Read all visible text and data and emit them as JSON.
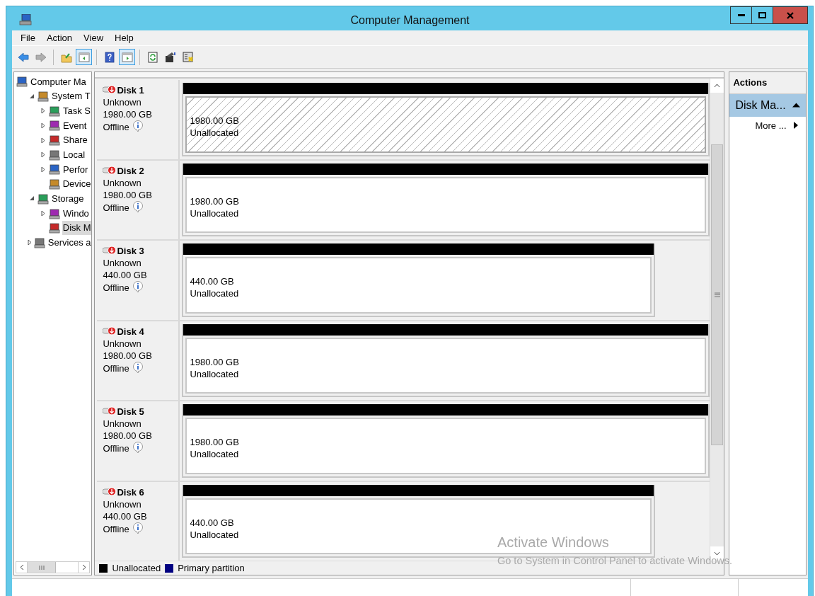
{
  "window": {
    "title": "Computer Management"
  },
  "menu": [
    "File",
    "Action",
    "View",
    "Help"
  ],
  "toolbar": [
    {
      "pressed": false,
      "disabled": false
    },
    {
      "pressed": false,
      "disabled": true
    },
    {
      "pressed": false,
      "disabled": false
    },
    {
      "pressed": true,
      "disabled": false
    },
    {
      "pressed": false,
      "disabled": false
    },
    {
      "pressed": true,
      "disabled": false
    },
    {
      "pressed": false,
      "disabled": false
    },
    {
      "pressed": false,
      "disabled": false
    },
    {
      "pressed": false,
      "disabled": false
    }
  ],
  "tree": [
    {
      "label": "Computer Ma",
      "selected": false,
      "children": [
        {
          "label": "System T",
          "selected": false,
          "expanded": true,
          "children": [
            {
              "label": "Task S",
              "selected": false,
              "expanded": false
            },
            {
              "label": "Event",
              "selected": false,
              "expanded": false
            },
            {
              "label": "Share",
              "selected": false,
              "expanded": false
            },
            {
              "label": "Local",
              "selected": false,
              "expanded": false
            },
            {
              "label": "Perfor",
              "selected": false,
              "expanded": false
            },
            {
              "label": "Device",
              "selected": false
            }
          ]
        },
        {
          "label": "Storage",
          "selected": false,
          "expanded": true,
          "children": [
            {
              "label": "Windo",
              "selected": false,
              "expanded": false
            },
            {
              "label": "Disk M",
              "selected": true
            }
          ]
        },
        {
          "label": "Services a",
          "selected": false,
          "expanded": false
        }
      ]
    }
  ],
  "disks": [
    {
      "name": "Disk 1",
      "type": "Unknown",
      "size": "1980.00 GB",
      "status": "Offline",
      "kind": "large",
      "selected": true,
      "partition": {
        "size": "1980.00 GB",
        "label": "Unallocated"
      }
    },
    {
      "name": "Disk 2",
      "type": "Unknown",
      "size": "1980.00 GB",
      "status": "Offline",
      "kind": "large",
      "selected": false,
      "partition": {
        "size": "1980.00 GB",
        "label": "Unallocated"
      }
    },
    {
      "name": "Disk 3",
      "type": "Unknown",
      "size": "440.00 GB",
      "status": "Offline",
      "kind": "small",
      "selected": false,
      "partition": {
        "size": "440.00 GB",
        "label": "Unallocated"
      }
    },
    {
      "name": "Disk 4",
      "type": "Unknown",
      "size": "1980.00 GB",
      "status": "Offline",
      "kind": "large",
      "selected": false,
      "partition": {
        "size": "1980.00 GB",
        "label": "Unallocated"
      }
    },
    {
      "name": "Disk 5",
      "type": "Unknown",
      "size": "1980.00 GB",
      "status": "Offline",
      "kind": "large",
      "selected": false,
      "partition": {
        "size": "1980.00 GB",
        "label": "Unallocated"
      }
    },
    {
      "name": "Disk 6",
      "type": "Unknown",
      "size": "440.00 GB",
      "status": "Offline",
      "kind": "small",
      "selected": false,
      "partition": {
        "size": "440.00 GB",
        "label": "Unallocated"
      }
    }
  ],
  "legend": [
    {
      "label": "Unallocated",
      "color": "#000000"
    },
    {
      "label": "Primary partition",
      "color": "#000080"
    }
  ],
  "actions": {
    "title": "Actions",
    "section": {
      "label": "Disk Ma...",
      "expanded": true,
      "items": [
        "More ..."
      ]
    }
  },
  "activation_notice": {
    "title": "Activate Windows",
    "text": "Go to System in Control Panel to activate Windows."
  }
}
